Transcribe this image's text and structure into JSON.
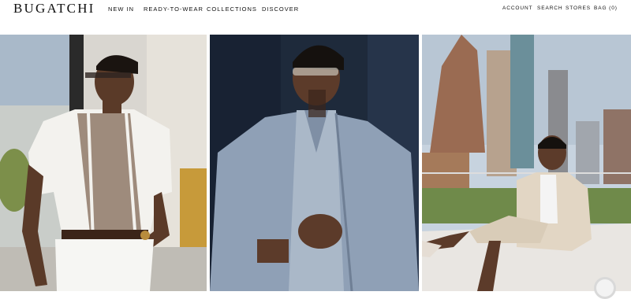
{
  "header": {
    "logo": "BUGATCHI",
    "nav": [
      "NEW IN",
      "READY-TO-WEAR",
      "COLLECTIONS",
      "DISCOVER"
    ],
    "utility": [
      "ACCOUNT",
      "SEARCH",
      "STORES",
      "BAG (0)"
    ]
  },
  "images": [
    {
      "name": "model-polo-outdoor",
      "alt": ""
    },
    {
      "name": "model-grey-shirt-jacket",
      "alt": ""
    },
    {
      "name": "model-city-rooftop",
      "alt": ""
    }
  ]
}
